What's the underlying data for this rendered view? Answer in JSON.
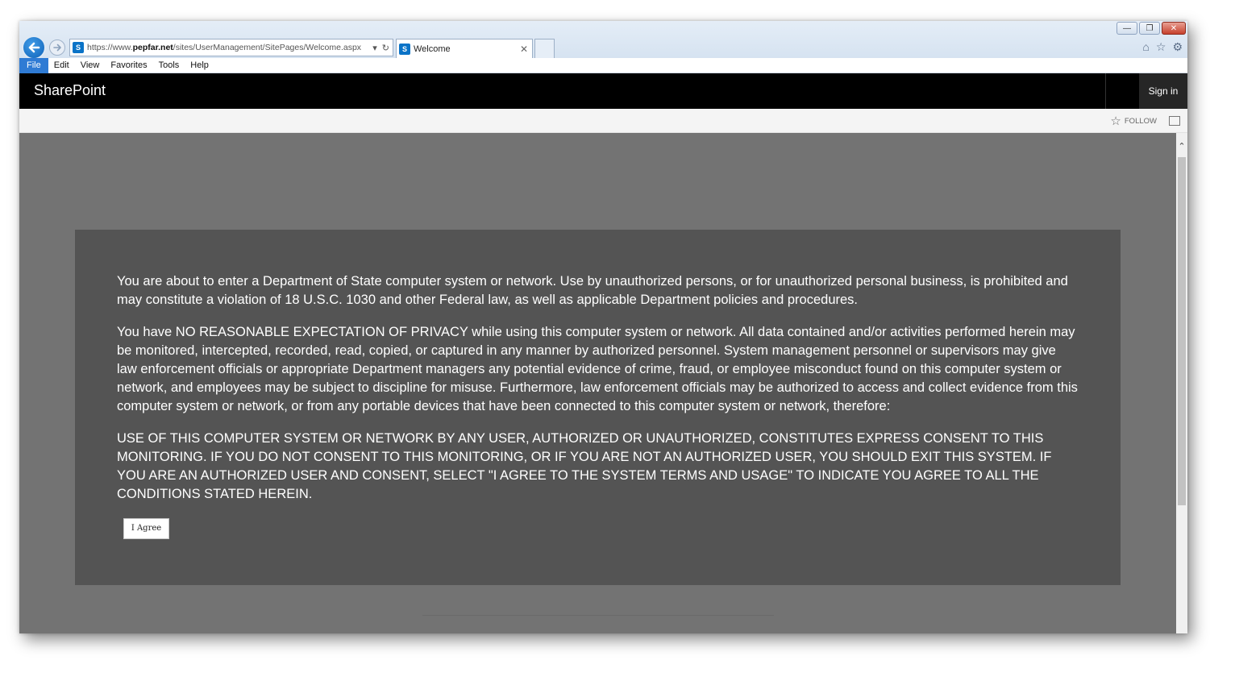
{
  "browser": {
    "window_controls": {
      "minimize": "—",
      "restore": "❐",
      "close": "✕"
    },
    "address_url_prefix": "https://www.",
    "address_url_domain": "pepfar.net",
    "address_url_path": "/sites/UserManagement/SitePages/Welcome.aspx",
    "tab_title": "Welcome",
    "menu": [
      "File",
      "Edit",
      "View",
      "Favorites",
      "Tools",
      "Help"
    ],
    "icons": [
      "back-arrow-icon",
      "forward-arrow-icon",
      "dropdown-icon",
      "refresh-icon",
      "home-icon",
      "favorites-star-icon",
      "settings-gear-icon"
    ]
  },
  "sharepoint": {
    "brand": "SharePoint",
    "sign_in": "Sign in",
    "follow": "FOLLOW"
  },
  "notice": {
    "paragraph1": "You are about to enter a Department of State computer system or network. Use by unauthorized persons, or for unauthorized personal business, is prohibited and may constitute a violation of 18 U.S.C. 1030 and other Federal law, as well as applicable Department policies and procedures.",
    "paragraph2": "You have NO REASONABLE EXPECTATION OF PRIVACY while using this computer system or network. All data contained and/or activities performed herein may be monitored, intercepted, recorded, read, copied, or captured in any manner by authorized personnel. System management personnel or supervisors may give law enforcement officials or appropriate Department managers any potential evidence of crime, fraud, or employee misconduct found on this computer system or network, and employees may be subject to discipline for misuse. Furthermore, law enforcement officials may be authorized to access and collect evidence from this computer system or network, or from any portable devices that have been connected to this computer system or network, therefore:",
    "paragraph3": "USE OF THIS COMPUTER SYSTEM OR NETWORK BY ANY USER, AUTHORIZED OR UNAUTHORIZED, CONSTITUTES EXPRESS CONSENT TO THIS MONITORING. IF YOU DO NOT CONSENT TO THIS MONITORING, OR IF YOU ARE NOT AN AUTHORIZED USER, YOU SHOULD EXIT THIS SYSTEM. IF YOU ARE AN AUTHORIZED USER AND CONSENT, SELECT \"I AGREE TO THE SYSTEM TERMS AND USAGE\" TO INDICATE YOU AGREE TO ALL THE CONDITIONS STATED HEREIN.",
    "agree_button": "I Agree"
  },
  "colors": {
    "suitebar": "#000000",
    "content_bg": "#737373",
    "notice_bg": "#545454",
    "menu_active": "#2f7bd4"
  }
}
